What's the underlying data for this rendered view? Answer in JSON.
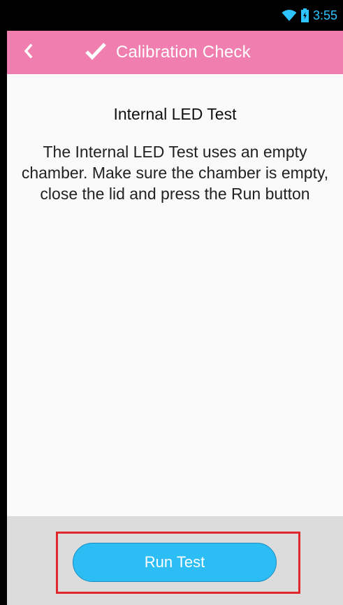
{
  "status_bar": {
    "time": "3:55",
    "wifi_icon": "wifi-icon",
    "battery_icon": "battery-icon"
  },
  "app_bar": {
    "back_icon": "chevron-left-icon",
    "title_icon": "checkmark-icon",
    "title": "Calibration Check",
    "color": "#f07fb0"
  },
  "content": {
    "heading": "Internal LED Test",
    "instructions": "The Internal LED Test uses an empty chamber. Make sure the chamber is empty, close the lid and press the Run button"
  },
  "actions": {
    "run_test_label": "Run Test",
    "button_color": "#2cbdf5",
    "highlight_color": "#e0282c"
  }
}
